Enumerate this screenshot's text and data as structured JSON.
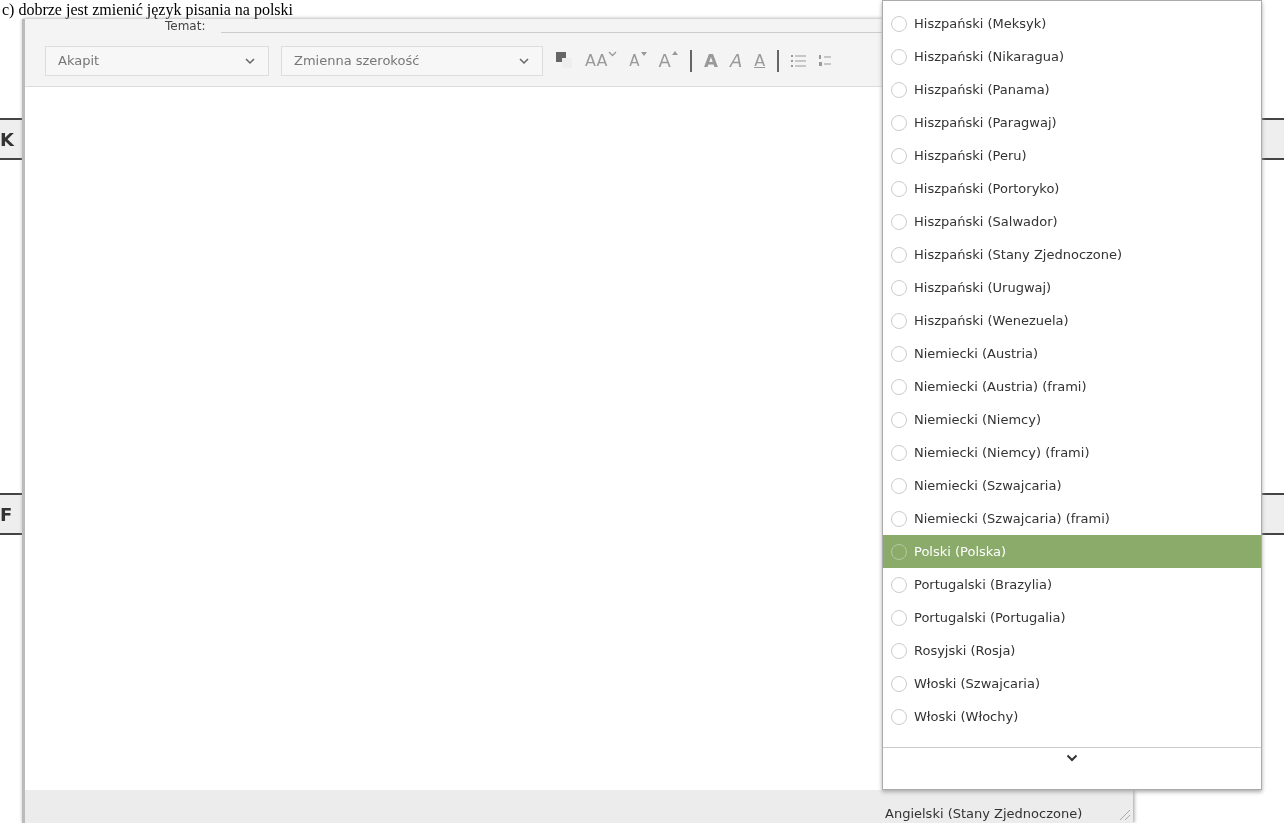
{
  "caption": "c) dobrze jest zmienić język pisania na polski",
  "background_document": {
    "headings": [
      "K",
      "F"
    ]
  },
  "compose": {
    "subject_label": "Temat:",
    "toolbar": {
      "paragraph_style": "Akapit",
      "font": "Zmienna szerokość",
      "buttons": [
        {
          "kind": "color"
        },
        {
          "kind": "sizes",
          "label": "AA"
        },
        {
          "kind": "smaller",
          "label": "A"
        },
        {
          "kind": "larger",
          "label": "A"
        },
        {
          "kind": "separator"
        },
        {
          "kind": "bold",
          "label": "A"
        },
        {
          "kind": "italic",
          "label": "A"
        },
        {
          "kind": "underline",
          "label": "A"
        },
        {
          "kind": "separator"
        },
        {
          "kind": "bullets"
        },
        {
          "kind": "numbers"
        }
      ]
    },
    "status_language": "Angielski (Stany Zjednoczone)"
  },
  "language_menu": {
    "items": [
      {
        "label": "Hiszpański (Meksyk)",
        "selected": false
      },
      {
        "label": "Hiszpański (Nikaragua)",
        "selected": false
      },
      {
        "label": "Hiszpański (Panama)",
        "selected": false
      },
      {
        "label": "Hiszpański (Paragwaj)",
        "selected": false
      },
      {
        "label": "Hiszpański (Peru)",
        "selected": false
      },
      {
        "label": "Hiszpański (Portoryko)",
        "selected": false
      },
      {
        "label": "Hiszpański (Salwador)",
        "selected": false
      },
      {
        "label": "Hiszpański (Stany Zjednoczone)",
        "selected": false
      },
      {
        "label": "Hiszpański (Urugwaj)",
        "selected": false
      },
      {
        "label": "Hiszpański (Wenezuela)",
        "selected": false
      },
      {
        "label": "Niemiecki (Austria)",
        "selected": false
      },
      {
        "label": "Niemiecki (Austria) (frami)",
        "selected": false
      },
      {
        "label": "Niemiecki (Niemcy)",
        "selected": false
      },
      {
        "label": "Niemiecki (Niemcy) (frami)",
        "selected": false
      },
      {
        "label": "Niemiecki (Szwajcaria)",
        "selected": false
      },
      {
        "label": "Niemiecki (Szwajcaria) (frami)",
        "selected": false
      },
      {
        "label": "Polski (Polska)",
        "selected": true
      },
      {
        "label": "Portugalski (Brazylia)",
        "selected": false
      },
      {
        "label": "Portugalski (Portugalia)",
        "selected": false
      },
      {
        "label": "Rosyjski (Rosja)",
        "selected": false
      },
      {
        "label": "Włoski (Szwajcaria)",
        "selected": false
      },
      {
        "label": "Włoski (Włochy)",
        "selected": false
      }
    ]
  }
}
